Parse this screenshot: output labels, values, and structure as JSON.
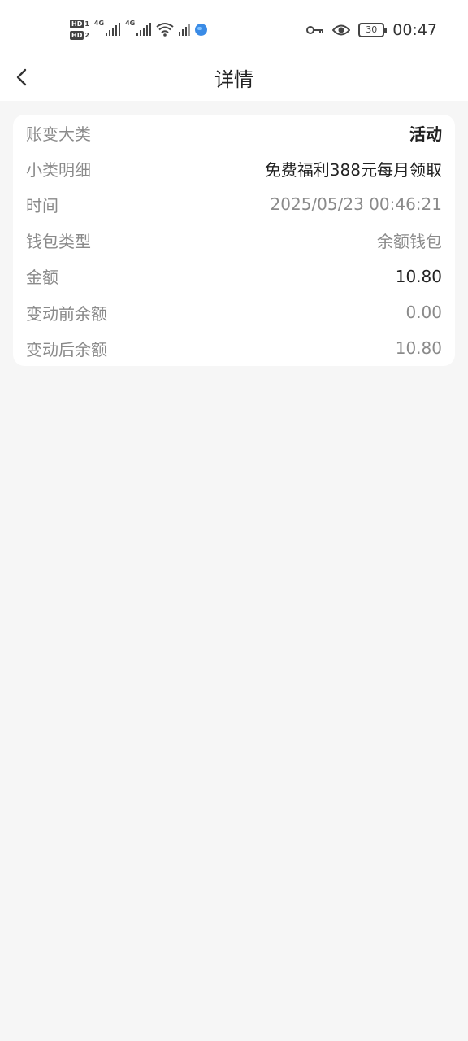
{
  "status_bar": {
    "sim1_tag": "HD",
    "sim1_num": "1",
    "sim2_tag": "HD",
    "sim2_num": "2",
    "net1": "4G",
    "net2": "4G",
    "battery": "30",
    "time": "00:47",
    "icons": [
      "signal-icon",
      "wifi-icon",
      "globe-icon",
      "key-icon",
      "eye-icon",
      "battery-icon"
    ]
  },
  "header": {
    "title": "详情",
    "back_icon": "chevron-left-icon"
  },
  "details": [
    {
      "label": "账变大类",
      "value": "活动"
    },
    {
      "label": "小类明细",
      "value": "免费福利388元每月领取"
    },
    {
      "label": "时间",
      "value": "2025/05/23 00:46:21"
    },
    {
      "label": "钱包类型",
      "value": "余额钱包"
    },
    {
      "label": "金额",
      "value": "10.80"
    },
    {
      "label": "变动前余额",
      "value": "0.00"
    },
    {
      "label": "变动后余额",
      "value": "10.80"
    }
  ],
  "colors": {
    "background": "#f6f6f6",
    "card": "#ffffff",
    "label": "#8a8a8a",
    "emphasis": "#222222"
  }
}
